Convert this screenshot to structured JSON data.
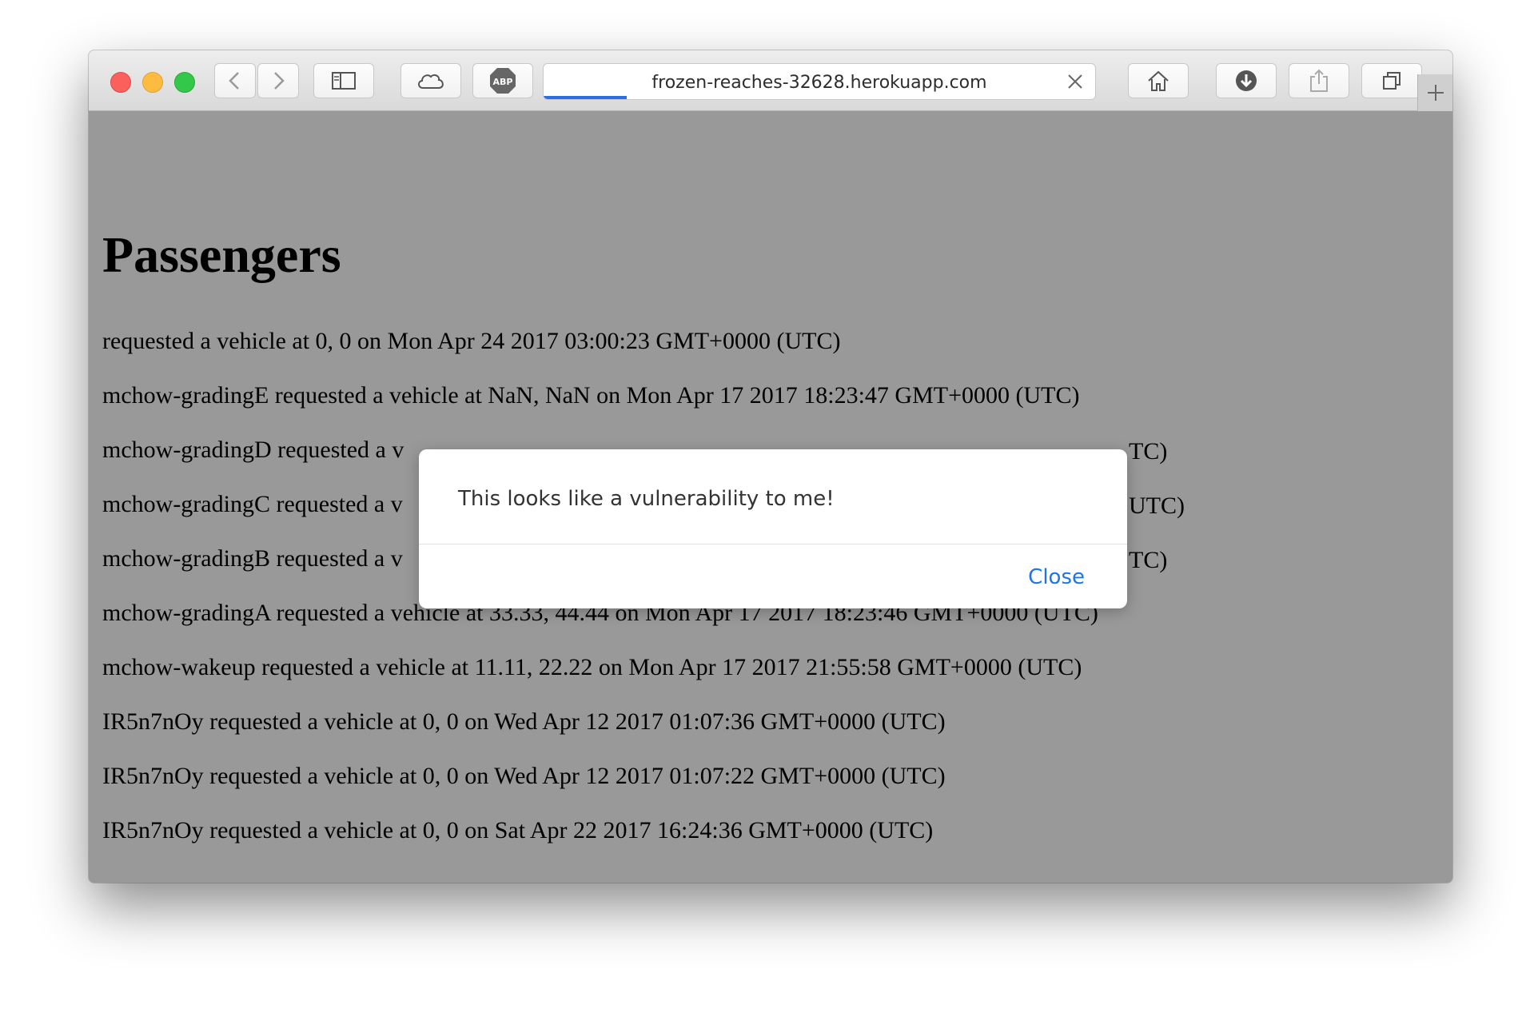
{
  "browser": {
    "url": "frozen-reaches-32628.herokuapp.com",
    "loading_progress": 0.15,
    "toolbar_icons": [
      "back-icon",
      "forward-icon",
      "sidebar-icon",
      "icloud-icon",
      "adblock-icon",
      "home-icon",
      "downloads-icon",
      "share-icon",
      "tabs-icon",
      "new-tab-icon"
    ],
    "adblock_label": "ABP",
    "new_tab_label": "+"
  },
  "page": {
    "title": "Passengers",
    "entries": [
      "requested a vehicle at 0, 0 on Mon Apr 24 2017 03:00:23 GMT+0000 (UTC)",
      "mchow-gradingE requested a vehicle at NaN, NaN on Mon Apr 17 2017 18:23:47 GMT+0000 (UTC)",
      "mchow-gradingD requested a v",
      "mchow-gradingC requested a v",
      "mchow-gradingB requested a v",
      "mchow-gradingA requested a vehicle at 33.33, 44.44 on Mon Apr 17 2017 18:23:46 GMT+0000 (UTC)",
      "mchow-wakeup requested a vehicle at 11.11, 22.22 on Mon Apr 17 2017 21:55:58 GMT+0000 (UTC)",
      "IR5n7nOy requested a vehicle at 0, 0 on Wed Apr 12 2017 01:07:36 GMT+0000 (UTC)",
      "IR5n7nOy requested a vehicle at 0, 0 on Wed Apr 12 2017 01:07:22 GMT+0000 (UTC)",
      "IR5n7nOy requested a vehicle at 0, 0 on Sat Apr 22 2017 16:24:36 GMT+0000 (UTC)"
    ],
    "partially_hidden_tails": [
      "TC)",
      "UTC)",
      "TC)"
    ]
  },
  "dialog": {
    "message": "This looks like a vulnerability to me!",
    "close_label": "Close"
  },
  "colors": {
    "overlay_background": "#999999",
    "link_blue": "#1f74e6",
    "progress_blue": "#2f6ee0"
  }
}
